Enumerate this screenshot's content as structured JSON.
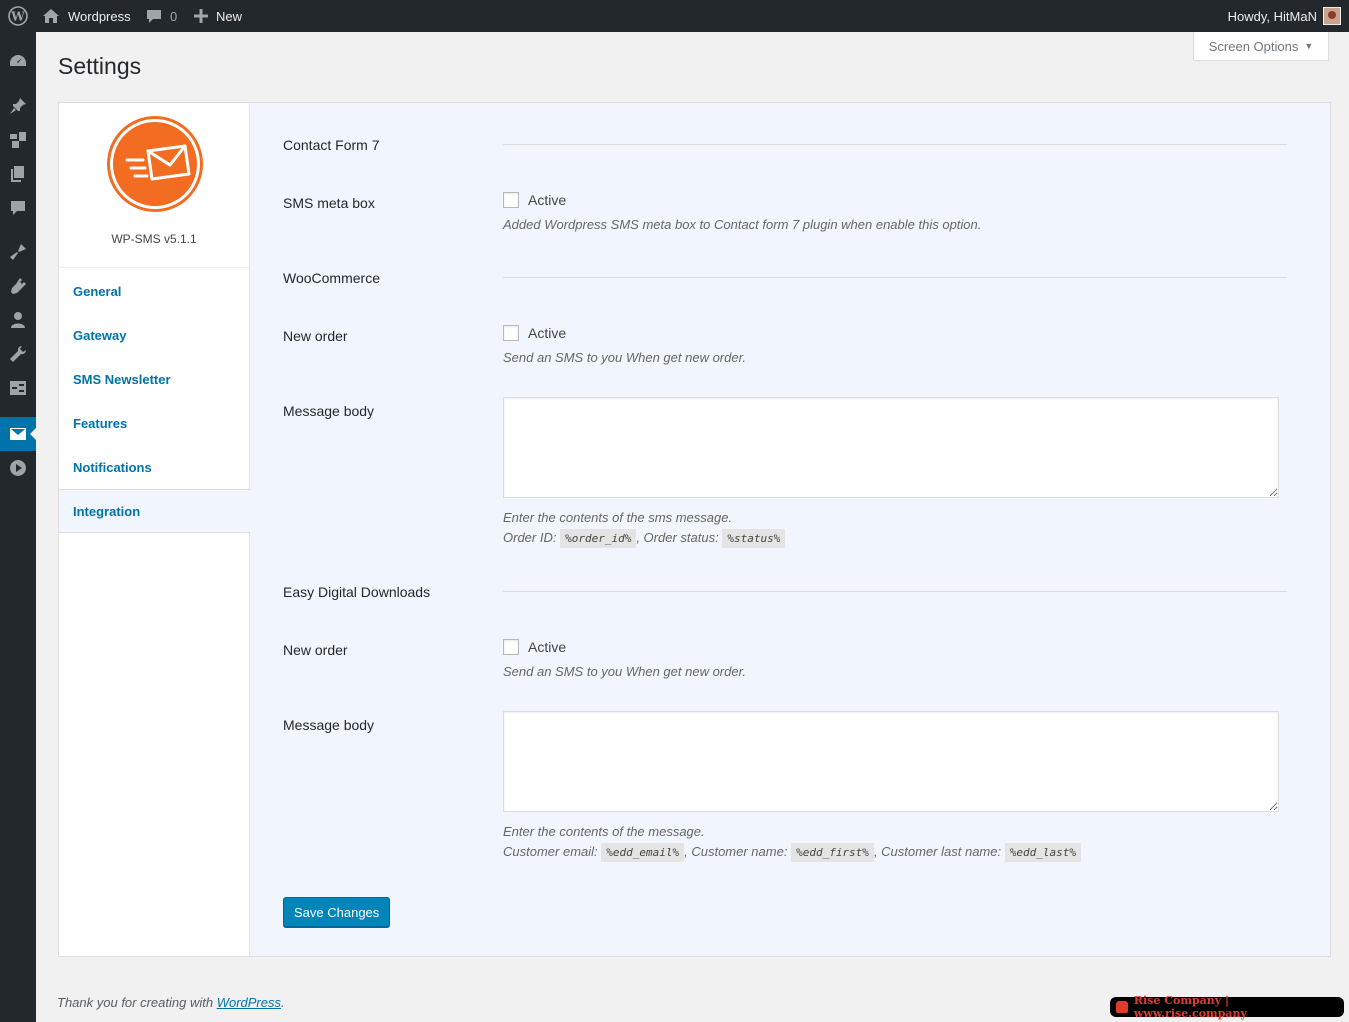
{
  "admin_bar": {
    "site_name": "Wordpress",
    "comments_count": "0",
    "new_label": "New",
    "howdy": "Howdy, HitMaN"
  },
  "sidebar": {
    "icons": [
      "dashboard-icon",
      "pin-icon",
      "media-icon",
      "pages-icon",
      "comments-icon",
      "appearance-icon",
      "plugins-icon",
      "users-icon",
      "tools-icon",
      "settings-icon",
      "sms-icon",
      "play-icon"
    ],
    "current": "sms-icon"
  },
  "header": {
    "title": "Settings",
    "screen_options": "Screen Options"
  },
  "plugin": {
    "version": "WP-SMS v5.1.1",
    "logo_color": "#f26d21"
  },
  "nav": {
    "items": [
      {
        "label": "General"
      },
      {
        "label": "Gateway"
      },
      {
        "label": "SMS Newsletter"
      },
      {
        "label": "Features"
      },
      {
        "label": "Notifications"
      },
      {
        "label": "Integration"
      }
    ],
    "active": "Integration"
  },
  "content": {
    "cf7": {
      "title": "Contact Form 7",
      "meta_box_label": "SMS meta box",
      "meta_box_check": "Active",
      "meta_box_desc": "Added Wordpress SMS meta box to Contact form 7 plugin when enable this option."
    },
    "woo": {
      "title": "WooCommerce",
      "new_order_label": "New order",
      "new_order_check": "Active",
      "new_order_desc": "Send an SMS to you When get new order.",
      "message_label": "Message body",
      "message_value": "",
      "message_desc": "Enter the contents of the sms message.",
      "vars_prefix_1": "Order ID:",
      "var_1": "%order_id%",
      "vars_prefix_2": ", Order status:",
      "var_2": "%status%"
    },
    "edd": {
      "title": "Easy Digital Downloads",
      "new_order_label": "New order",
      "new_order_check": "Active",
      "new_order_desc": "Send an SMS to you When get new order.",
      "message_label": "Message body",
      "message_value": "",
      "message_desc": "Enter the contents of the message.",
      "vars_prefix_1": "Customer email:",
      "var_1": "%edd_email%",
      "vars_prefix_2": ", Customer name:",
      "var_2": "%edd_first%",
      "vars_prefix_3": ", Customer last name:",
      "var_3": "%edd_last%"
    },
    "save_label": "Save Changes"
  },
  "footer": {
    "text": "Thank you for creating with",
    "link": "WordPress",
    "period": "."
  },
  "watermark": "Rise Company | www.rise.company",
  "colors": {
    "accent": "#0073aa",
    "button": "#0085ba",
    "admin_bar": "#23282d"
  }
}
